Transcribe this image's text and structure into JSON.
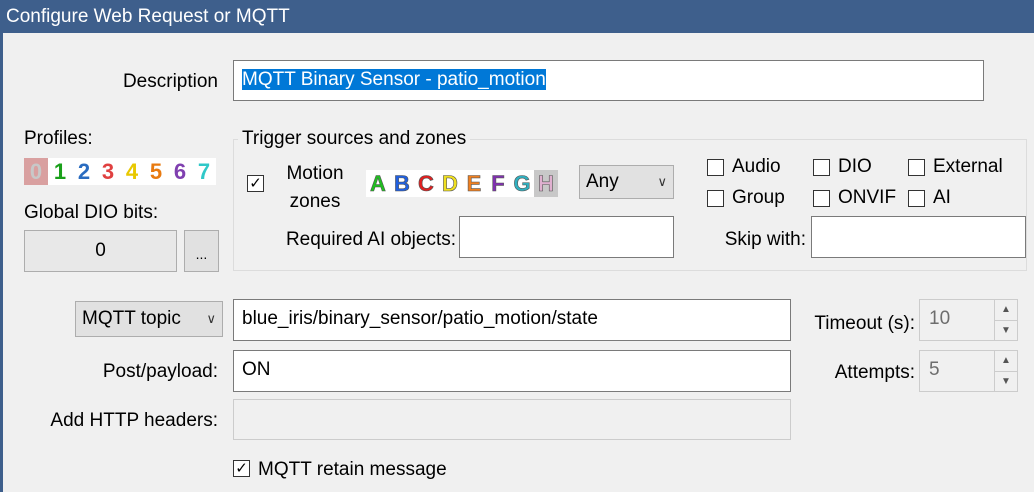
{
  "window": {
    "title": "Configure Web Request or MQTT"
  },
  "description": {
    "label": "Description",
    "value": "MQTT Binary Sensor - patio_motion"
  },
  "profiles": {
    "label": "Profiles:",
    "digits": [
      {
        "t": "0",
        "color": "#c8c8c8",
        "bg": "#d9a0a0"
      },
      {
        "t": "1",
        "color": "#1aa01a"
      },
      {
        "t": "2",
        "color": "#2a6cc0"
      },
      {
        "t": "3",
        "color": "#e04040"
      },
      {
        "t": "4",
        "color": "#e8c800"
      },
      {
        "t": "5",
        "color": "#e87a10"
      },
      {
        "t": "6",
        "color": "#8040b0"
      },
      {
        "t": "7",
        "color": "#30c8c8"
      }
    ]
  },
  "dio": {
    "label": "Global DIO bits:",
    "value": "0",
    "button": "..."
  },
  "trigger": {
    "legend": "Trigger sources and zones",
    "motion_checked": true,
    "motion_line1": "Motion",
    "motion_line2": "zones",
    "zones": [
      {
        "t": "A",
        "color": "#20c020"
      },
      {
        "t": "B",
        "color": "#2060e0"
      },
      {
        "t": "C",
        "color": "#e02020"
      },
      {
        "t": "D",
        "color": "#f0e020"
      },
      {
        "t": "E",
        "color": "#f08020"
      },
      {
        "t": "F",
        "color": "#8030b0"
      },
      {
        "t": "G",
        "color": "#30b0c0"
      },
      {
        "t": "H",
        "color": "#e0b0d0",
        "bg": "#c8c8c8"
      }
    ],
    "zone_mode": "Any",
    "checks": [
      {
        "label": "Audio",
        "checked": false
      },
      {
        "label": "DIO",
        "checked": false
      },
      {
        "label": "External",
        "checked": false
      },
      {
        "label": "Group",
        "checked": false
      },
      {
        "label": "ONVIF",
        "checked": false
      },
      {
        "label": "AI",
        "checked": false
      }
    ],
    "ai_label": "Required AI objects:",
    "ai_value": "",
    "skip_label": "Skip with:",
    "skip_value": ""
  },
  "request": {
    "type": "MQTT topic",
    "topic": "blue_iris/binary_sensor/patio_motion/state",
    "payload_label": "Post/payload:",
    "payload": "ON",
    "headers_label": "Add HTTP headers:",
    "headers": "",
    "timeout_label": "Timeout (s):",
    "timeout": "10",
    "attempts_label": "Attempts:",
    "attempts": "5",
    "retain_label": "MQTT retain message",
    "retain_checked": true
  }
}
